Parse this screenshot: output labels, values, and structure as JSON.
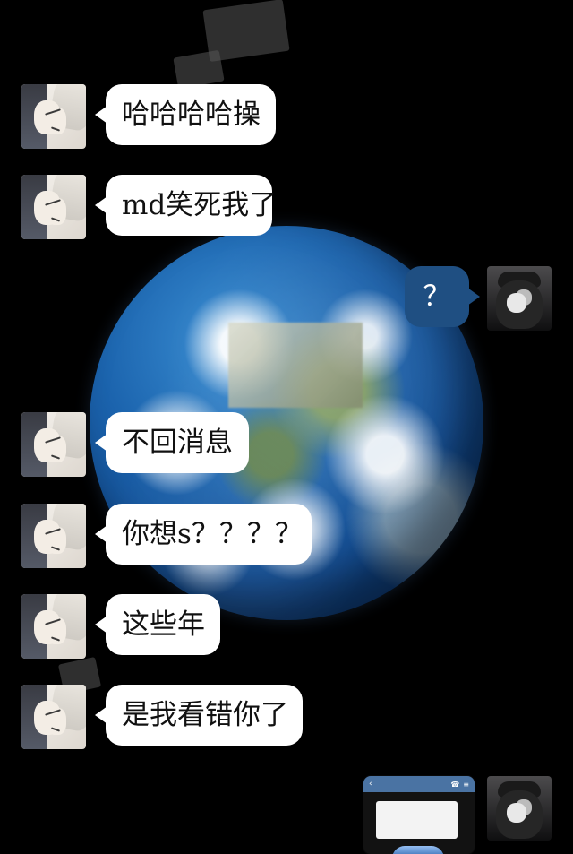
{
  "messages": [
    {
      "text": "哈哈哈哈操",
      "side": "left"
    },
    {
      "text": "md笑死我了",
      "side": "left"
    },
    {
      "text": "？",
      "side": "right"
    },
    {
      "text": "不回消息",
      "side": "left"
    },
    {
      "text": "你想s？？？？",
      "side": "left"
    },
    {
      "text": "这些年",
      "side": "left"
    },
    {
      "text": "是我看错你了",
      "side": "left"
    }
  ],
  "colors": {
    "background": "#000000",
    "left_bubble": "#ffffff",
    "right_bubble": "#1f4f82"
  },
  "icons": {
    "left_avatar": "anime-avatar-icon",
    "right_avatar": "hooded-user-avatar-icon",
    "background": "earth-icon"
  }
}
